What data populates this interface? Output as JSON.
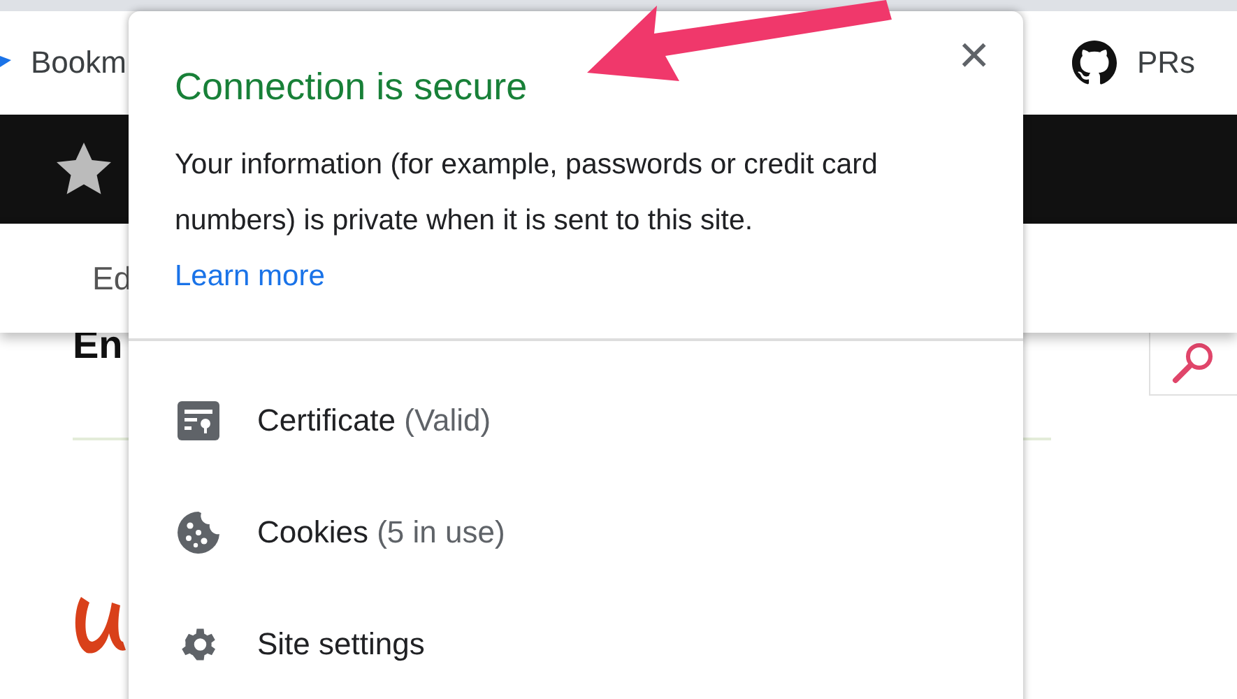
{
  "bookmarks_bar": {
    "items": [
      {
        "label": "Bookm"
      },
      {
        "label": "PRs"
      }
    ]
  },
  "site_header": {
    "nav_label": "Ed"
  },
  "page": {
    "heading": "En"
  },
  "popup": {
    "title": "Connection is secure",
    "description": "Your information (for example, passwords or credit card numbers) is private when it is sent to this site.",
    "link": "Learn more",
    "close": "×",
    "items": [
      {
        "label": "Certificate",
        "detail": "(Valid)"
      },
      {
        "label": "Cookies",
        "detail": "(5 in use)"
      },
      {
        "label": "Site settings"
      }
    ]
  }
}
